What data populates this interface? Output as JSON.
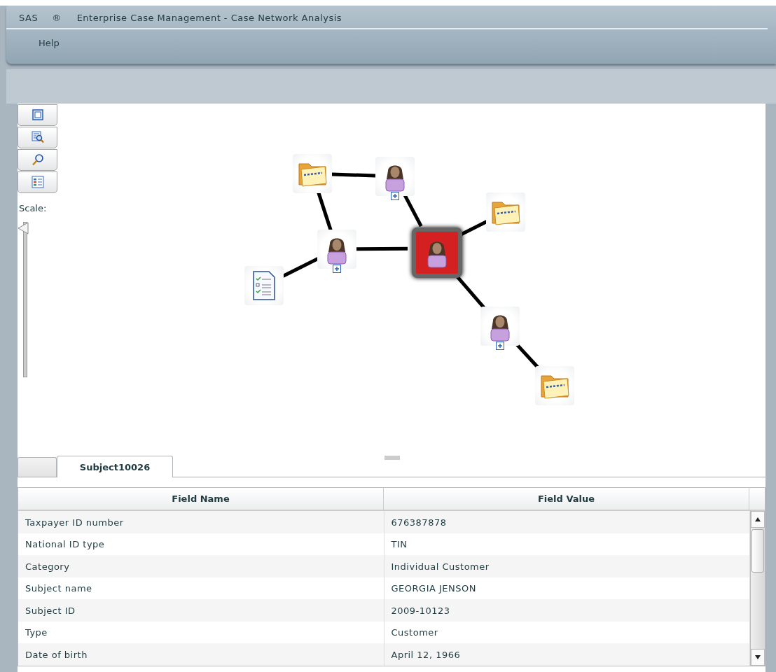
{
  "window": {
    "title": "Enterprise Case Management - Case Network Analysis",
    "brand": "SAS",
    "brand_mark": "®"
  },
  "menu": [
    "Help"
  ],
  "toolbar": {
    "buttons": [
      {
        "kind": "fit"
      },
      {
        "kind": "zoom-area"
      },
      {
        "kind": "zoom"
      },
      {
        "kind": "legend"
      }
    ],
    "scale_label": "Scale:",
    "scale": {
      "level": 1
    }
  },
  "network": {
    "nodes": [
      {
        "kind": "folder",
        "selected": false,
        "expandable": false
      },
      {
        "kind": "person",
        "selected": false,
        "expandable": true
      },
      {
        "kind": "folder",
        "selected": false,
        "expandable": false
      },
      {
        "kind": "person",
        "selected": false,
        "expandable": true
      },
      {
        "kind": "person",
        "selected": true,
        "expandable": false
      },
      {
        "kind": "document",
        "selected": false,
        "expandable": false
      },
      {
        "kind": "person",
        "selected": false,
        "expandable": true
      },
      {
        "kind": "folder",
        "selected": false,
        "expandable": false
      }
    ]
  },
  "tabs": [
    {
      "selected": false
    },
    {
      "label": "Subject10026",
      "selected": true
    }
  ],
  "table": {
    "columns": [
      "Field Name",
      "Field Value"
    ],
    "rows": [
      [
        "Taxpayer ID number",
        "676387878"
      ],
      [
        "National ID type",
        "TIN"
      ],
      [
        "Category",
        "Individual Customer"
      ],
      [
        "Subject name",
        "GEORGIA JENSON"
      ],
      [
        "Subject ID",
        "2009-10123"
      ],
      [
        "Type",
        "Customer"
      ],
      [
        "Date of birth",
        "April 12, 1966"
      ]
    ]
  }
}
